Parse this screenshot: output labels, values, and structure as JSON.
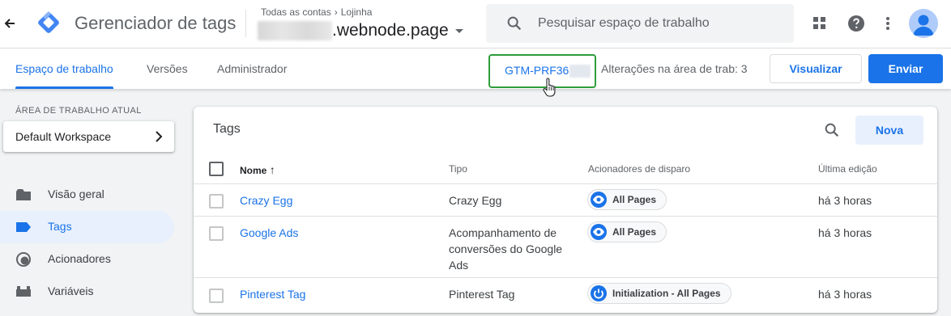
{
  "header": {
    "app_title": "Gerenciador de tags",
    "breadcrumb_account": "Todas as contas",
    "breadcrumb_separator": "›",
    "breadcrumb_container": "Lojinha",
    "container_name_suffix": ".webnode.page",
    "search_placeholder": "Pesquisar espaço de trabalho"
  },
  "subnav": {
    "tabs": [
      {
        "label": "Espaço de trabalho",
        "active": true
      },
      {
        "label": "Versões",
        "active": false
      },
      {
        "label": "Administrador",
        "active": false
      }
    ],
    "container_id": "GTM-PRF36",
    "changes_text": "Alterações na área de trab: 3",
    "preview_label": "Visualizar",
    "submit_label": "Enviar"
  },
  "sidebar": {
    "workspace_label": "ÁREA DE TRABALHO ATUAL",
    "workspace_name": "Default Workspace",
    "items": [
      {
        "label": "Visão geral",
        "icon": "folder-icon",
        "active": false
      },
      {
        "label": "Tags",
        "icon": "tag-icon",
        "active": true
      },
      {
        "label": "Acionadores",
        "icon": "trigger-icon",
        "active": false
      },
      {
        "label": "Variáveis",
        "icon": "variables-icon",
        "active": false
      }
    ]
  },
  "tags_panel": {
    "title": "Tags",
    "new_label": "Nova",
    "columns": {
      "name": "Nome",
      "sort_indicator": "↑",
      "type": "Tipo",
      "triggers": "Acionadores de disparo",
      "last_edit": "Última edição"
    },
    "rows": [
      {
        "name": "Crazy Egg",
        "type": "Crazy Egg",
        "trigger": "All Pages",
        "trigger_icon": "eye-icon",
        "last_edit": "há 3 horas"
      },
      {
        "name": "Google Ads",
        "type": "Acompanhamento de conversões do Google Ads",
        "trigger": "All Pages",
        "trigger_icon": "eye-icon",
        "last_edit": "há 3 horas"
      },
      {
        "name": "Pinterest Tag",
        "type": "Pinterest Tag",
        "trigger": "Initialization - All Pages",
        "trigger_icon": "power-icon",
        "last_edit": "há 3 horas"
      }
    ]
  },
  "colors": {
    "accent": "#1a73e8",
    "highlight_border": "#2e9d3a",
    "sidebar_bg": "#f1f3f4",
    "active_nav_bg": "#e8f0fe"
  }
}
